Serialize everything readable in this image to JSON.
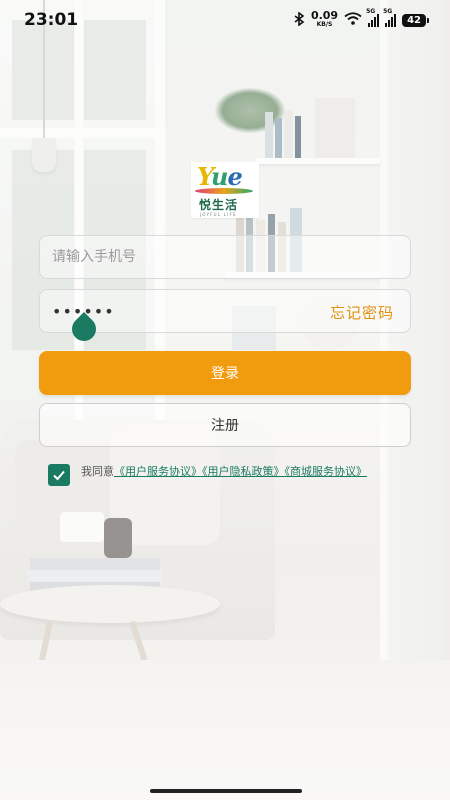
{
  "status_bar": {
    "time": "23:01",
    "net_speed": "0.09",
    "net_unit": "KB/S",
    "sim1": "5G",
    "sim2": "5G",
    "battery": "42"
  },
  "logo": {
    "brand_latin": "Yue",
    "brand_cn": "悦生活",
    "brand_en": "JOYFUL LIFE"
  },
  "form": {
    "phone_placeholder": "请输入手机号",
    "password_value": "••••••",
    "forgot_label": "忘记密码",
    "login_label": "登录",
    "register_label": "注册"
  },
  "agreement": {
    "checked": true,
    "prefix": "我同意",
    "user_agreement": "《用户服务协议》",
    "privacy_policy": "《用户隐私政策》",
    "mall_agreement": "《商城服务协议》"
  },
  "colors": {
    "accent": "#f19b0e",
    "forgot": "#e0900f",
    "brand_green": "#1a7a62"
  }
}
